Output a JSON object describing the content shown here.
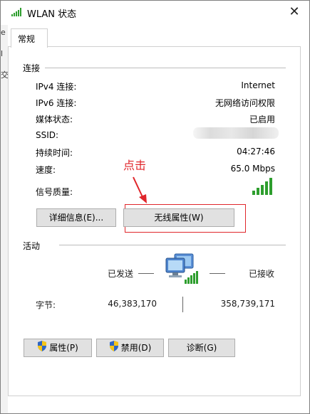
{
  "window": {
    "title": "WLAN 状态"
  },
  "tabs": [
    {
      "label": "常规"
    }
  ],
  "connection": {
    "group_label": "连接",
    "rows": [
      {
        "label": "IPv4 连接:",
        "value": "Internet"
      },
      {
        "label": "IPv6 连接:",
        "value": "无网络访问权限"
      },
      {
        "label": "媒体状态:",
        "value": "已启用"
      },
      {
        "label": "SSID:",
        "value": ""
      },
      {
        "label": "持续时间:",
        "value": "04:27:46"
      },
      {
        "label": "速度:",
        "value": "65.0 Mbps"
      },
      {
        "label": "信号质量:",
        "value": ""
      }
    ],
    "signal_bars_filled": 5,
    "signal_bars_total": 5,
    "details_button": "详细信息(E)...",
    "wireless_button": "无线属性(W)"
  },
  "annotation": {
    "text": "点击",
    "color": "#e0262b"
  },
  "activity": {
    "group_label": "活动",
    "sent_label": "已发送",
    "received_label": "已接收",
    "bytes_label": "字节:",
    "bytes_sent": "46,383,170",
    "bytes_received": "358,739,171"
  },
  "bottom_buttons": {
    "properties": "属性(P)",
    "disable": "禁用(D)",
    "diagnose": "诊断(G)"
  },
  "background_fragments": [
    "e",
    "l",
    "交"
  ],
  "colors": {
    "signal_green": "#2e9e2e",
    "annotation_red": "#e0262b"
  }
}
